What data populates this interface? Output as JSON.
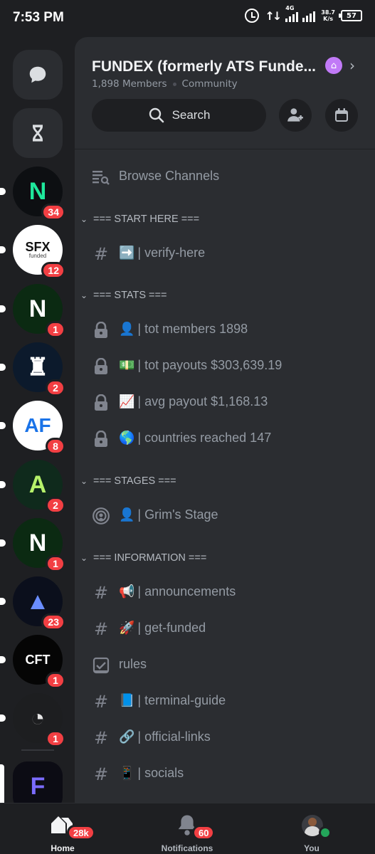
{
  "status_bar": {
    "time": "7:53 PM",
    "network": "4G",
    "speed": "38.7",
    "speed_unit": "K/s",
    "battery": "57"
  },
  "servers": [
    {
      "name": "Direct Messages",
      "icon": "chat-bubble-icon",
      "type": "button"
    },
    {
      "name": "Threads",
      "icon": "hourglass-icon",
      "type": "button"
    },
    {
      "name": "N server",
      "logo": "N",
      "bg": "#0d0f12",
      "fg": "#1ee89c",
      "badge": "34"
    },
    {
      "name": "SFX Funded",
      "logo": "SFX",
      "sub": "funded",
      "bg": "#ffffff",
      "fg": "#111111",
      "badge": "12"
    },
    {
      "name": "N green server",
      "logo": "N",
      "bg": "#0b2a12",
      "fg": "#ffffff",
      "badge": "1"
    },
    {
      "name": "Castle server",
      "logo": "♜",
      "bg": "#0c1a2c",
      "fg": "#ffffff",
      "badge": "2"
    },
    {
      "name": "AF server",
      "logo": "AF",
      "bg": "#ffffff",
      "fg": "#1a73e8",
      "badge": "8"
    },
    {
      "name": "A green server",
      "logo": "A",
      "bg": "#0f2a1c",
      "fg": "#b6f26a",
      "badge": "2"
    },
    {
      "name": "N green server 2",
      "logo": "N",
      "bg": "#0b2a12",
      "fg": "#ffffff",
      "badge": "1"
    },
    {
      "name": "Arrow server",
      "logo": "▲",
      "bg": "#0b0f1c",
      "fg": "#6a8dff",
      "badge": "23"
    },
    {
      "name": "CFT server",
      "logo": "CFT",
      "bg": "#050505",
      "fg": "#ffffff",
      "badge": "1"
    },
    {
      "name": "Chart server",
      "logo": "◔",
      "bg": "#1d1e20",
      "fg": "#e6e6e6",
      "badge": "1"
    },
    {
      "name": "FUNDEX",
      "logo": "F",
      "bg": "#0c0c14",
      "fg": "#7b6cff",
      "badge": ""
    }
  ],
  "server": {
    "name": "FUNDEX (formerly ATS Funde...",
    "members": "1,898 Members",
    "type": "Community",
    "search_label": "Search"
  },
  "channels": {
    "browse": "Browse Channels",
    "categories": [
      {
        "label": "=== START HERE ==="
      },
      {
        "label": "=== STATS ==="
      },
      {
        "label": "=== STAGES ==="
      },
      {
        "label": "=== INFORMATION ==="
      }
    ],
    "items": [
      {
        "emoji": "➡️",
        "name": "| verify-here",
        "icon": "hash-icon"
      },
      {
        "emoji": "👤",
        "name": "| tot members 1898",
        "icon": "lock-icon"
      },
      {
        "emoji": "💵",
        "name": "| tot payouts $303,639.19",
        "icon": "lock-icon"
      },
      {
        "emoji": "📈",
        "name": "| avg payout $1,168.13",
        "icon": "lock-icon"
      },
      {
        "emoji": "🌎",
        "name": "| countries reached 147",
        "icon": "lock-icon"
      },
      {
        "emoji": "👤",
        "name": "| Grim's Stage",
        "icon": "stage-icon"
      },
      {
        "emoji": "📢",
        "name": "| announcements",
        "icon": "hash-icon"
      },
      {
        "emoji": "🚀",
        "name": "| get-funded",
        "icon": "hash-icon"
      },
      {
        "emoji": "",
        "name": "rules",
        "icon": "rules-icon"
      },
      {
        "emoji": "📘",
        "name": "| terminal-guide",
        "icon": "hash-icon"
      },
      {
        "emoji": "🔗",
        "name": "| official-links",
        "icon": "hash-icon"
      },
      {
        "emoji": "📱",
        "name": "| socials",
        "icon": "hash-icon"
      }
    ]
  },
  "bottom_nav": {
    "home": {
      "label": "Home",
      "badge": "28k"
    },
    "notifications": {
      "label": "Notifications",
      "badge": "60"
    },
    "you": {
      "label": "You"
    }
  },
  "colors": {
    "accent": "#5865f2",
    "badge": "#f23f43",
    "online": "#23a55a",
    "boost": "#c17af7"
  }
}
